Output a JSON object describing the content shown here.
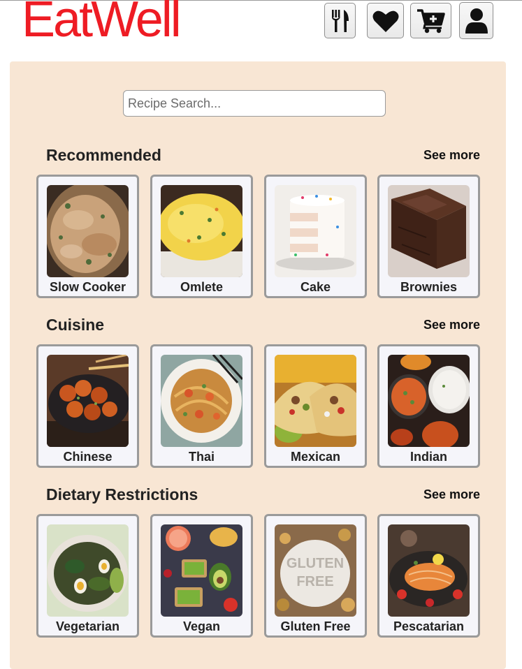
{
  "header": {
    "logo": "EatWell",
    "brand_color": "#ee1c24",
    "icons": [
      "utensils-icon",
      "heart-icon",
      "cart-plus-icon",
      "user-icon"
    ]
  },
  "search": {
    "placeholder": "Recipe Search..."
  },
  "sections": [
    {
      "title": "Recommended",
      "see_more": "See more",
      "cards": [
        {
          "label": "Slow Cooker"
        },
        {
          "label": "Omlete"
        },
        {
          "label": "Cake"
        },
        {
          "label": "Brownies"
        }
      ]
    },
    {
      "title": "Cuisine",
      "see_more": "See more",
      "cards": [
        {
          "label": "Chinese"
        },
        {
          "label": "Thai"
        },
        {
          "label": "Mexican"
        },
        {
          "label": "Indian"
        }
      ]
    },
    {
      "title": "Dietary Restrictions",
      "see_more": "See more",
      "cards": [
        {
          "label": "Vegetarian"
        },
        {
          "label": "Vegan"
        },
        {
          "label": "Gluten Free"
        },
        {
          "label": "Pescatarian"
        }
      ]
    }
  ],
  "colors": {
    "panel_background": "#f8e6d4",
    "card_background": "#f5f5fa",
    "card_border": "#9a9a9a"
  }
}
